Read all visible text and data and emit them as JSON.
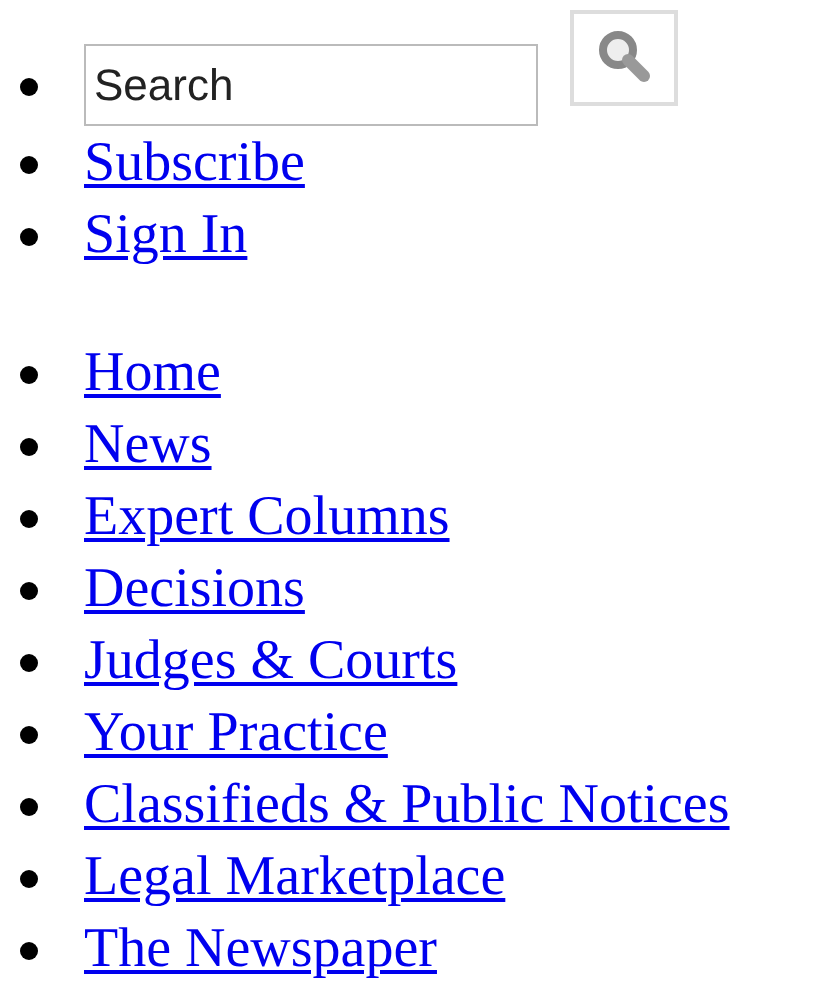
{
  "top_links": {
    "search": {
      "value": "Search"
    },
    "links": [
      "Subscribe",
      "Sign In"
    ]
  },
  "nav": [
    "Home",
    "News",
    "Expert Columns",
    "Decisions",
    "Judges & Courts",
    "Your Practice",
    "Classifieds & Public Notices",
    "Legal Marketplace",
    "The Newspaper"
  ]
}
